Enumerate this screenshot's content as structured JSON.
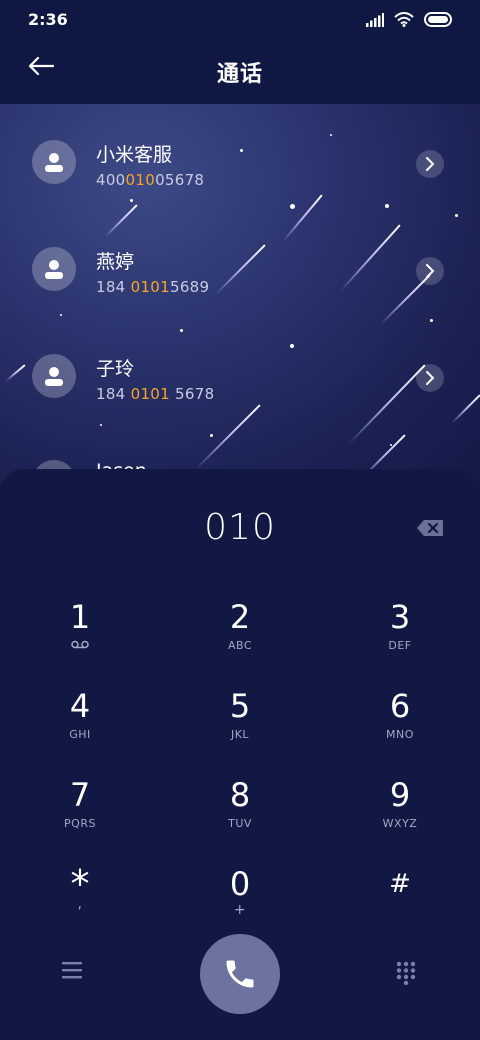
{
  "status_bar": {
    "time": "2:36"
  },
  "header": {
    "title": "通话"
  },
  "contacts": [
    {
      "name": "小米客服",
      "number_pre": "400",
      "number_hl": "010",
      "number_post": "05678"
    },
    {
      "name": "燕婷",
      "number_pre": "184 ",
      "number_hl": "0101",
      "number_post": "5689"
    },
    {
      "name": "子玲",
      "number_pre": "184 ",
      "number_hl": "0101",
      "number_post": " 5678"
    },
    {
      "name": "Jason",
      "number_pre": "",
      "number_hl": "",
      "number_post": ""
    }
  ],
  "dialer": {
    "input": "010",
    "keys": [
      {
        "digit": "1",
        "letters": ""
      },
      {
        "digit": "2",
        "letters": "ABC"
      },
      {
        "digit": "3",
        "letters": "DEF"
      },
      {
        "digit": "4",
        "letters": "GHI"
      },
      {
        "digit": "5",
        "letters": "JKL"
      },
      {
        "digit": "6",
        "letters": "MNO"
      },
      {
        "digit": "7",
        "letters": "PQRS"
      },
      {
        "digit": "8",
        "letters": "TUV"
      },
      {
        "digit": "9",
        "letters": "WXYZ"
      },
      {
        "digit": "*",
        "letters": ","
      },
      {
        "digit": "0",
        "letters": "+"
      },
      {
        "digit": "#",
        "letters": ""
      }
    ]
  },
  "colors": {
    "background": "#101843",
    "highlight": "#f6a623",
    "call_button": "#6d73a0"
  }
}
